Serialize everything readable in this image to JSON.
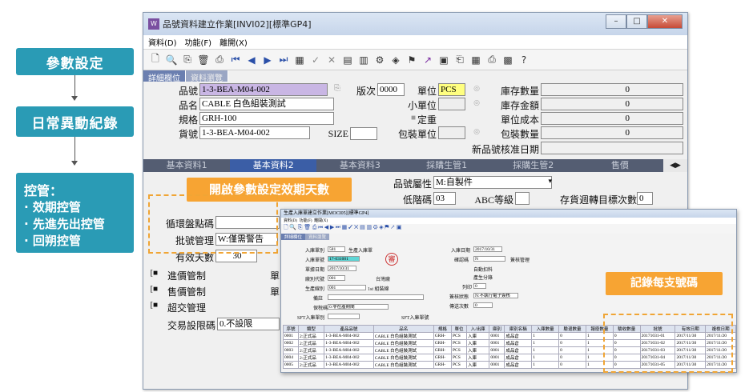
{
  "flow": {
    "step1": "參數設定",
    "step2": "日常異動紀錄",
    "step3_title": "控管：",
    "step3_items": [
      "· 效期控管",
      "· 先進先出控管",
      "· 回朔控管"
    ]
  },
  "main_window": {
    "title": "品號資料建立作業[INVI02][標準GP4]",
    "menu": [
      "資料(D)",
      "功能(F)",
      "離開(X)"
    ],
    "upper_tabs": [
      "詳細欄位",
      "資料瀏覽"
    ],
    "fields": {
      "item_no_label": "品號",
      "item_no": "1-3-BEA-M04-002",
      "version_label": "版次",
      "version": "0000",
      "unit_label": "單位",
      "unit": "PCS",
      "stock_qty_label": "庫存數量",
      "stock_qty": "0",
      "name_label": "品名",
      "name": "CABLE 白色組裝測試",
      "sub_unit_label": "小單位",
      "stock_amt_label": "庫存金額",
      "stock_amt": "0",
      "spec_label": "規格",
      "spec": "GRH-100",
      "fixed_weight_label": "定重",
      "unit_cost_label": "單位成本",
      "unit_cost": "0",
      "goods_no_label": "貨號",
      "goods_no": "1-3-BEA-M04-002",
      "size_label": "SIZE",
      "pack_unit_label": "包裝單位",
      "pack_qty_label": "包裝數量",
      "pack_qty": "0",
      "new_item_date_label": "新品號核准日期"
    },
    "lower_tabs": [
      "基本資料1",
      "基本資料2",
      "基本資料3",
      "採購生管1",
      "採購生管2",
      "售價"
    ],
    "basic2": {
      "attr_label": "品號屬性",
      "attr": "M:自製件",
      "low_code_label": "低階碼",
      "low_code": "03",
      "abc_label": "ABC等級",
      "turnover_label": "存貨週轉目標次數",
      "turnover": "0",
      "cycle_label": "循環盤點碼",
      "batch_label": "批號管理",
      "batch": "W:僅需警告",
      "valid_days_label": "有效天數",
      "valid_days": "30",
      "incoming_label": "進價管制",
      "sales_label": "售價管制",
      "over_label": "超交管理",
      "trade_limit_label": "交易設限碼",
      "trade_limit": "0.不設限",
      "unit_short_1": "單",
      "unit_short_2": "單"
    },
    "callout": "開啟參數設定效期天數"
  },
  "sub_window": {
    "title": "生產入庫單建立作業[MOCI05][標準GP4]",
    "fields": {
      "type_label": "入庫單別",
      "type": "581",
      "type_name": "生產入庫單",
      "no_label": "入庫單號",
      "no": "17-031001",
      "date_label": "單據日期",
      "date": "2017/10/31",
      "factory_label": "廠別代號",
      "factory": "001",
      "factory_name": "台灣廠",
      "prod_label": "生產線別",
      "prod": "001",
      "prod_name": "1st 組裝線",
      "remark_label": "備註",
      "conf_label": "確認碼",
      "conf_name": "簽核管理",
      "conf_value": "N",
      "rin_date_label": "入庫日期",
      "rin_date": "2017/10/31",
      "auto_label": "自動扣料",
      "gen_label": "產生分錄",
      "print_label": "列印",
      "print": "0",
      "sign_label": "簽核狀態",
      "sign": "N:不執行電子簽核",
      "send_label": "傳送次數",
      "send": "0",
      "tax_label": "保稅碼",
      "tax": "0.非在產期間",
      "sft_label": "SFT入庫單別",
      "sft2_label": "SFT入庫單號"
    },
    "tabs": [
      "詳細欄位",
      "資料瀏覽"
    ],
    "grid_headers": [
      "序號",
      "類型",
      "產品品號",
      "品名",
      "規格",
      "單位",
      "入/出庫",
      "庫別",
      "庫別名稱",
      "入庫數量",
      "驗退數量",
      "報廢數量",
      "驗收數量",
      "批號",
      "有效日期",
      "複檢日期"
    ],
    "grid_rows": [
      [
        "0001",
        "2:正式品",
        "1-3-BEA-M04-002",
        "CABLE 白色組裝測試",
        "GRH-",
        "PCS",
        "入庫",
        "0001",
        "成品倉",
        "1",
        "0",
        "1",
        "0",
        "20171031-01",
        "2017/11/30",
        "2017/11/20"
      ],
      [
        "0002",
        "2:正式品",
        "1-3-BEA-M04-002",
        "CABLE 白色組裝測試",
        "GRH-",
        "PCS",
        "入庫",
        "0001",
        "成品倉",
        "1",
        "0",
        "1",
        "0",
        "20171031-02",
        "2017/11/30",
        "2017/11/20"
      ],
      [
        "0003",
        "2:正式品",
        "1-3-BEA-M04-002",
        "CABLE 白色組裝測試",
        "GRH-",
        "PCS",
        "入庫",
        "0001",
        "成品倉",
        "1",
        "0",
        "1",
        "0",
        "20171031-03",
        "2017/11/30",
        "2017/11/20"
      ],
      [
        "0004",
        "2:正式品",
        "1-3-BEA-M04-002",
        "CABLE 白色組裝測試",
        "GRH-",
        "PCS",
        "入庫",
        "0001",
        "成品倉",
        "1",
        "0",
        "1",
        "0",
        "20171031-04",
        "2017/11/30",
        "2017/11/20"
      ],
      [
        "0005",
        "2:正式品",
        "1-3-BEA-M04-002",
        "CABLE 白色組裝測試",
        "GRH-",
        "PCS",
        "入庫",
        "0001",
        "成品倉",
        "1",
        "0",
        "1",
        "0",
        "20171031-05",
        "2017/11/30",
        "2017/11/20"
      ]
    ],
    "callout": "記錄每支號碼"
  }
}
